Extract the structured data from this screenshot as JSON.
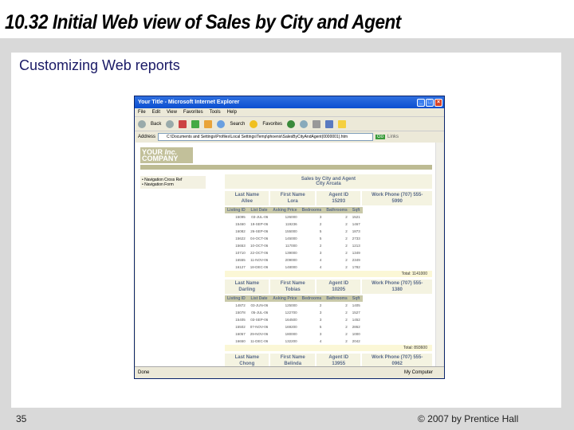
{
  "slide": {
    "title": "10.32 Initial Web view of Sales by City and Agent",
    "subtitle": "Customizing Web reports",
    "page_number": "35",
    "copyright": "© 2007 by Prentice Hall"
  },
  "browser": {
    "window_title": "Your Title - Microsoft Internet Explorer",
    "menu": [
      "File",
      "Edit",
      "View",
      "Favorites",
      "Tools",
      "Help"
    ],
    "toolbar": {
      "back": "Back",
      "search": "Search",
      "favorites": "Favorites"
    },
    "address_label": "Address",
    "address": "C:\\Documents and Settings\\Profiles\\Local Settings\\Temp\\phoenix\\SalesByCityAndAgent(0000001).htm",
    "go": "Go",
    "links": "Links",
    "status": "Done",
    "zone": "My Computer"
  },
  "page": {
    "logo": "YOUR Inc. COMPANY",
    "nav": [
      "Navigation Cross Ref",
      "Navigation Form"
    ],
    "report_title": "Sales by City and Agent",
    "city": "City Arcata",
    "columns": [
      "Listing ID",
      "List Date",
      "Asking Price",
      "Bedrooms",
      "Bathrooms",
      "Sqft"
    ],
    "agents": [
      {
        "last_label": "Last Name",
        "last": "Allee",
        "first_label": "First Name",
        "first": "Lora",
        "id_label": "Agent ID",
        "id": "15293",
        "phone_label": "Work Phone (707) 555-",
        "phone": "5990",
        "rows": [
          [
            "15095",
            "03-JUL-06",
            "126000",
            "3",
            "2",
            "1521"
          ],
          [
            "15460",
            "19-SEP-06",
            "119236",
            "2",
            "2",
            "1467"
          ],
          [
            "16082",
            "26-SEP-06",
            "155000",
            "5",
            "2",
            "1873"
          ],
          [
            "15622",
            "04-OCT-06",
            "145000",
            "5",
            "2",
            "2733"
          ],
          [
            "15653",
            "10-OCT-06",
            "117000",
            "2",
            "2",
            "1213"
          ],
          [
            "10710",
            "22-OCT-06",
            "139000",
            "3",
            "2",
            "1349"
          ],
          [
            "16555",
            "11-NOV-06",
            "209000",
            "4",
            "2",
            "2349"
          ],
          [
            "16127",
            "18-DEC-06",
            "148000",
            "4",
            "2",
            "1782"
          ]
        ],
        "total": "Total: 1141000"
      },
      {
        "last_label": "Last Name",
        "last": "Darling",
        "first_label": "First Name",
        "first": "Tobias",
        "id_label": "Agent ID",
        "id": "10205",
        "phone_label": "Work Phone (707) 555-",
        "phone": "1380",
        "rows": [
          [
            "14872",
            "03-JUN-06",
            "125000",
            "2",
            "2",
            "1405"
          ],
          [
            "15078",
            "05-JUL-06",
            "122700",
            "3",
            "2",
            "1527"
          ],
          [
            "15405",
            "03-SEP-06",
            "164500",
            "3",
            "2",
            "1452"
          ],
          [
            "15502",
            "07-NOV-06",
            "169200",
            "5",
            "2",
            "2862"
          ],
          [
            "16057",
            "29-NOV-06",
            "180000",
            "3",
            "2",
            "1000"
          ],
          [
            "16650",
            "11-DEC-06",
            "132200",
            "4",
            "2",
            "2042"
          ]
        ],
        "total": "Total: 893600"
      },
      {
        "last_label": "Last Name",
        "last": "Chong",
        "first_label": "First Name",
        "first": "Belinda",
        "id_label": "Agent ID",
        "id": "13955",
        "phone_label": "Work Phone (707) 555-",
        "phone": "0962",
        "rows": [],
        "total": ""
      }
    ]
  }
}
